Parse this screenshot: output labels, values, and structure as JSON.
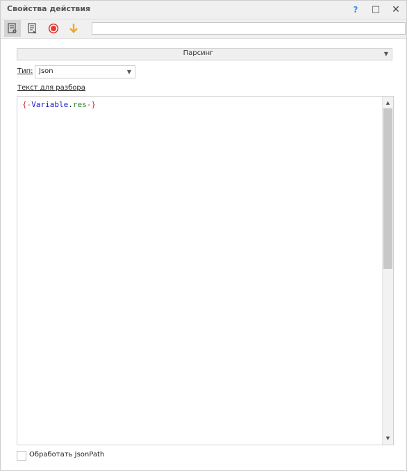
{
  "window": {
    "title": "Свойства действия",
    "help_label": "?",
    "maximize_label": "□",
    "close_label": "✕"
  },
  "toolbar": {
    "buttons": [
      {
        "icon": "properties-icon"
      },
      {
        "icon": "description-icon"
      },
      {
        "icon": "record-icon",
        "color": "#e53935"
      },
      {
        "icon": "arrow-down-icon",
        "color": "#f5a623"
      }
    ],
    "name_input": {
      "value": "",
      "placeholder": ""
    }
  },
  "action": {
    "selected": "Парсинг"
  },
  "type": {
    "label": "Тип:",
    "value": "Json"
  },
  "text_section": {
    "label": "Текст для разбора",
    "code": {
      "open": "{-",
      "variable": "Variable",
      "dot": ".",
      "res": "res",
      "close": "-}"
    }
  },
  "option": {
    "label": "Обработать JsonPath",
    "checked": false
  }
}
